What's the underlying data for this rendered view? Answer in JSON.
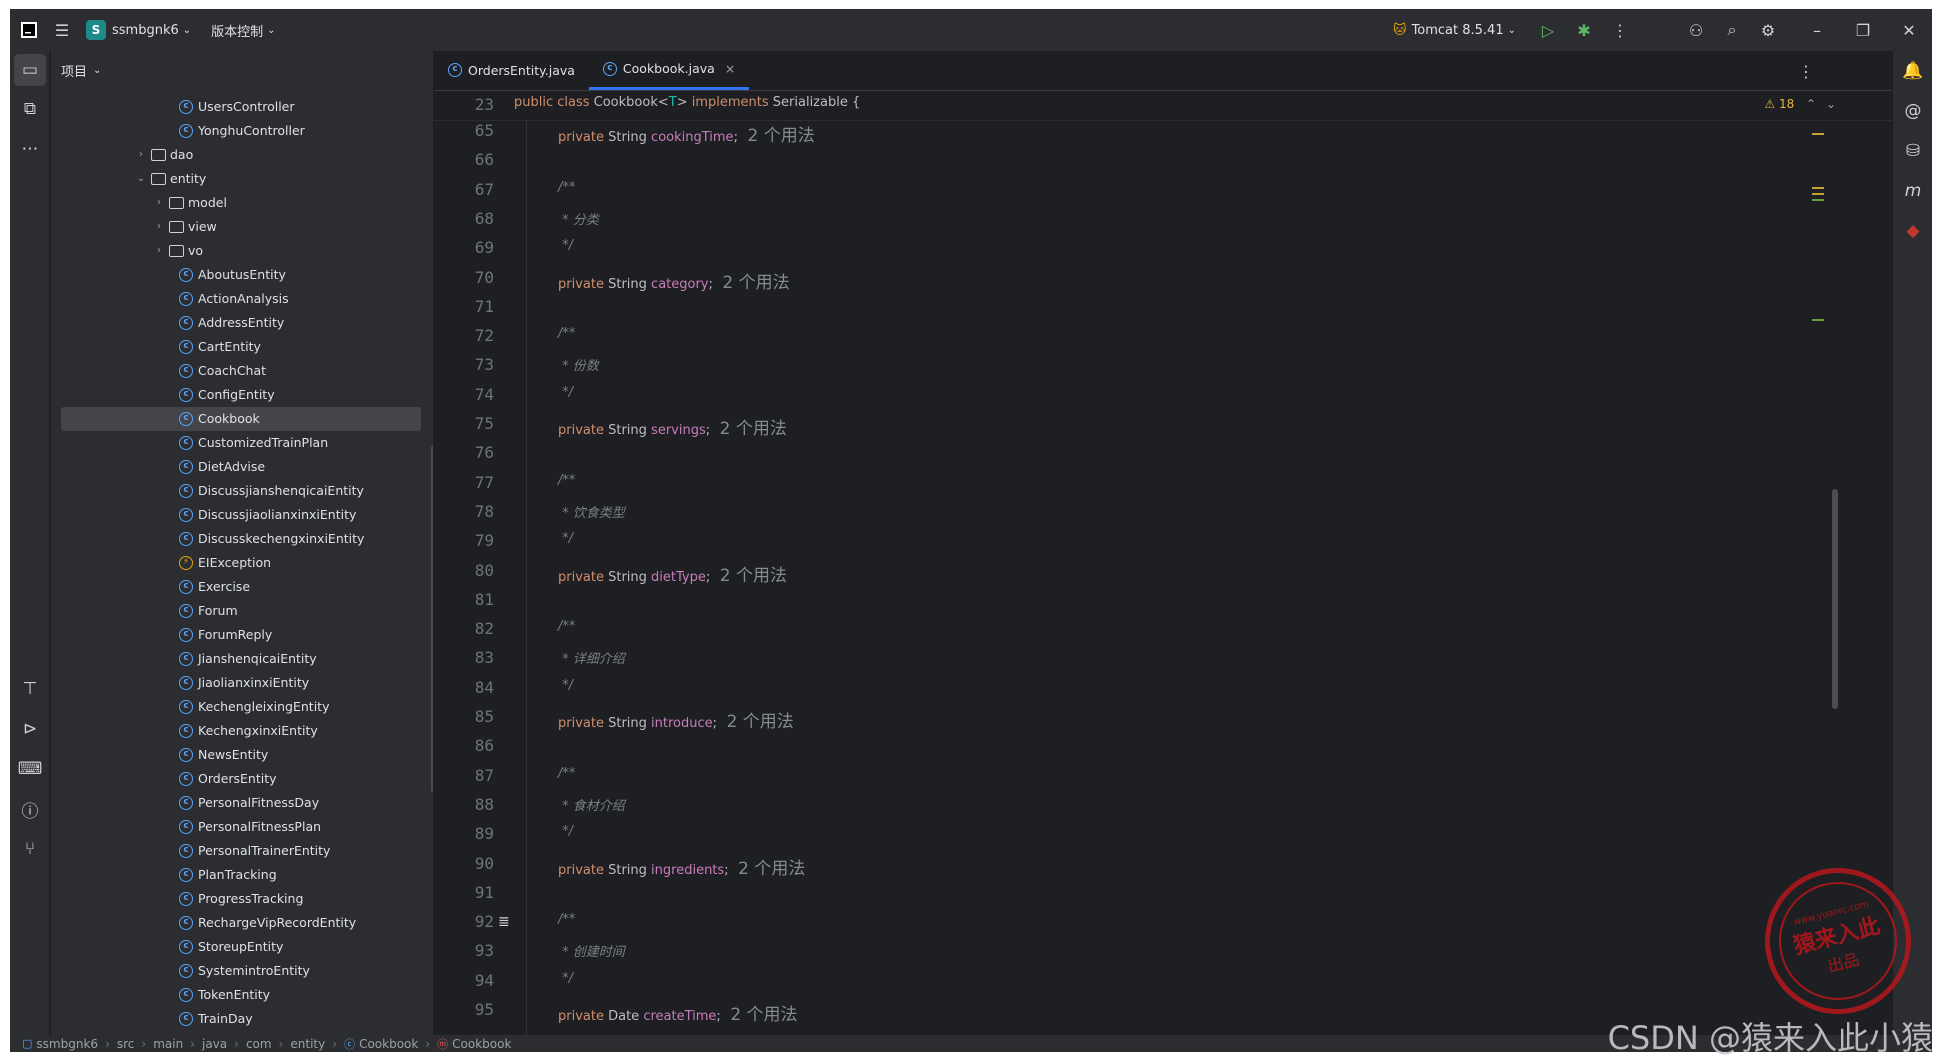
{
  "titlebar": {
    "project_badge": "S",
    "project_name": "ssmbgnk6",
    "vcs": "版本控制",
    "run_config": "Tomcat 8.5.41"
  },
  "project_panel": {
    "title": "项目",
    "rows": [
      {
        "label": "UsersController",
        "type": "class",
        "depth": 0
      },
      {
        "label": "YonghuController",
        "type": "class",
        "depth": 0
      },
      {
        "label": "dao",
        "type": "folder",
        "depth": -1,
        "expanded": false
      },
      {
        "label": "entity",
        "type": "folder",
        "depth": -1,
        "expanded": true
      },
      {
        "label": "model",
        "type": "folder",
        "depth": 0,
        "expanded": false
      },
      {
        "label": "view",
        "type": "folder",
        "depth": 0,
        "expanded": false
      },
      {
        "label": "vo",
        "type": "folder",
        "depth": 0,
        "expanded": false
      },
      {
        "label": "AboutusEntity",
        "type": "class",
        "depth": 0
      },
      {
        "label": "ActionAnalysis",
        "type": "class",
        "depth": 0
      },
      {
        "label": "AddressEntity",
        "type": "class",
        "depth": 0
      },
      {
        "label": "CartEntity",
        "type": "class",
        "depth": 0
      },
      {
        "label": "CoachChat",
        "type": "class",
        "depth": 0
      },
      {
        "label": "ConfigEntity",
        "type": "class",
        "depth": 0
      },
      {
        "label": "Cookbook",
        "type": "class",
        "depth": 0,
        "selected": true
      },
      {
        "label": "CustomizedTrainPlan",
        "type": "class",
        "depth": 0
      },
      {
        "label": "DietAdvise",
        "type": "class",
        "depth": 0
      },
      {
        "label": "DiscussjianshenqicaiEntity",
        "type": "class",
        "depth": 0
      },
      {
        "label": "DiscussjiaolianxinxiEntity",
        "type": "class",
        "depth": 0
      },
      {
        "label": "DiscusskechengxinxiEntity",
        "type": "class",
        "depth": 0
      },
      {
        "label": "EIException",
        "type": "exception",
        "depth": 0
      },
      {
        "label": "Exercise",
        "type": "class",
        "depth": 0
      },
      {
        "label": "Forum",
        "type": "class",
        "depth": 0
      },
      {
        "label": "ForumReply",
        "type": "class",
        "depth": 0
      },
      {
        "label": "JianshenqicaiEntity",
        "type": "class",
        "depth": 0
      },
      {
        "label": "JiaolianxinxiEntity",
        "type": "class",
        "depth": 0
      },
      {
        "label": "KechengleixingEntity",
        "type": "class",
        "depth": 0
      },
      {
        "label": "KechengxinxiEntity",
        "type": "class",
        "depth": 0
      },
      {
        "label": "NewsEntity",
        "type": "class",
        "depth": 0
      },
      {
        "label": "OrdersEntity",
        "type": "class",
        "depth": 0
      },
      {
        "label": "PersonalFitnessDay",
        "type": "class",
        "depth": 0
      },
      {
        "label": "PersonalFitnessPlan",
        "type": "class",
        "depth": 0
      },
      {
        "label": "PersonalTrainerEntity",
        "type": "class",
        "depth": 0
      },
      {
        "label": "PlanTracking",
        "type": "class",
        "depth": 0
      },
      {
        "label": "ProgressTracking",
        "type": "class",
        "depth": 0
      },
      {
        "label": "RechargeVipRecordEntity",
        "type": "class",
        "depth": 0
      },
      {
        "label": "StoreupEntity",
        "type": "class",
        "depth": 0
      },
      {
        "label": "SystemintroEntity",
        "type": "class",
        "depth": 0
      },
      {
        "label": "TokenEntity",
        "type": "class",
        "depth": 0
      },
      {
        "label": "TrainDay",
        "type": "class",
        "depth": 0
      }
    ]
  },
  "editor": {
    "tabs": [
      {
        "label": "OrdersEntity.java",
        "active": false
      },
      {
        "label": "Cookbook.java",
        "active": true
      }
    ],
    "sticky": {
      "line": "23",
      "code": [
        [
          "kw",
          "public class "
        ],
        [
          "t",
          "Cookbook<"
        ],
        [
          "gp",
          "T"
        ],
        [
          "t",
          "> "
        ],
        [
          "kw",
          "implements "
        ],
        [
          "t",
          "Serializable {"
        ]
      ]
    },
    "warnings": "18",
    "lines": [
      {
        "n": "65",
        "code": [
          [
            "kw",
            "private "
          ],
          [
            "t",
            "String "
          ],
          [
            "fld",
            "cookingTime"
          ],
          [
            "t",
            "; "
          ],
          [
            "hint",
            " 2 个用法"
          ]
        ]
      },
      {
        "n": "66",
        "code": []
      },
      {
        "n": "67",
        "code": [
          [
            "cmt",
            "/**"
          ]
        ]
      },
      {
        "n": "68",
        "code": [
          [
            "cmt",
            " * 分类"
          ]
        ]
      },
      {
        "n": "69",
        "code": [
          [
            "cmt",
            " */"
          ]
        ]
      },
      {
        "n": "70",
        "code": [
          [
            "kw",
            "private "
          ],
          [
            "t",
            "String "
          ],
          [
            "fld",
            "category"
          ],
          [
            "t",
            "; "
          ],
          [
            "hint",
            " 2 个用法"
          ]
        ]
      },
      {
        "n": "71",
        "code": []
      },
      {
        "n": "72",
        "code": [
          [
            "cmt",
            "/**"
          ]
        ]
      },
      {
        "n": "73",
        "code": [
          [
            "cmt",
            " * 份数"
          ]
        ]
      },
      {
        "n": "74",
        "code": [
          [
            "cmt",
            " */"
          ]
        ]
      },
      {
        "n": "75",
        "code": [
          [
            "kw",
            "private "
          ],
          [
            "t",
            "String "
          ],
          [
            "fld",
            "servings"
          ],
          [
            "t",
            "; "
          ],
          [
            "hint",
            " 2 个用法"
          ]
        ]
      },
      {
        "n": "76",
        "code": []
      },
      {
        "n": "77",
        "code": [
          [
            "cmt",
            "/**"
          ]
        ]
      },
      {
        "n": "78",
        "code": [
          [
            "cmt",
            " * 饮食类型"
          ]
        ]
      },
      {
        "n": "79",
        "code": [
          [
            "cmt",
            " */"
          ]
        ]
      },
      {
        "n": "80",
        "code": [
          [
            "kw",
            "private "
          ],
          [
            "t",
            "String "
          ],
          [
            "fld",
            "dietType"
          ],
          [
            "t",
            "; "
          ],
          [
            "hint",
            " 2 个用法"
          ]
        ]
      },
      {
        "n": "81",
        "code": []
      },
      {
        "n": "82",
        "code": [
          [
            "cmt",
            "/**"
          ]
        ]
      },
      {
        "n": "83",
        "code": [
          [
            "cmt",
            " * 详细介绍"
          ]
        ]
      },
      {
        "n": "84",
        "code": [
          [
            "cmt",
            " */"
          ]
        ]
      },
      {
        "n": "85",
        "code": [
          [
            "kw",
            "private "
          ],
          [
            "t",
            "String "
          ],
          [
            "fld",
            "introduce"
          ],
          [
            "t",
            "; "
          ],
          [
            "hint",
            " 2 个用法"
          ]
        ]
      },
      {
        "n": "86",
        "code": []
      },
      {
        "n": "87",
        "code": [
          [
            "cmt",
            "/**"
          ]
        ]
      },
      {
        "n": "88",
        "code": [
          [
            "cmt",
            " * 食材介绍"
          ]
        ]
      },
      {
        "n": "89",
        "code": [
          [
            "cmt",
            " */"
          ]
        ]
      },
      {
        "n": "90",
        "code": [
          [
            "kw",
            "private "
          ],
          [
            "t",
            "String "
          ],
          [
            "fld",
            "ingredients"
          ],
          [
            "t",
            "; "
          ],
          [
            "hint",
            " 2 个用法"
          ]
        ]
      },
      {
        "n": "91",
        "code": []
      },
      {
        "n": "92",
        "code": [
          [
            "cmt",
            "/**"
          ]
        ]
      },
      {
        "n": "93",
        "code": [
          [
            "cmt",
            " * 创建时间"
          ]
        ]
      },
      {
        "n": "94",
        "code": [
          [
            "cmt",
            " */"
          ]
        ]
      },
      {
        "n": "95",
        "code": [
          [
            "kw",
            "private "
          ],
          [
            "t",
            "Date "
          ],
          [
            "fld",
            "createTime"
          ],
          [
            "t",
            "; "
          ],
          [
            "hint",
            " 2 个用法"
          ]
        ]
      }
    ]
  },
  "statusbar": {
    "crumbs": [
      "ssmbgnk6",
      "src",
      "main",
      "java",
      "com",
      "entity",
      "Cookbook",
      "Cookbook"
    ]
  },
  "watermark": "CSDN @猿来入此小猿",
  "stamp": {
    "top": "www.yuanrc.com",
    "mid": "猿来入此",
    "bottom": "出品"
  },
  "colors": {
    "accent": "#3574f0",
    "keyword": "#cf8e6d",
    "field": "#c77dbb",
    "comment": "#7a7e85",
    "generic": "#16baac"
  }
}
